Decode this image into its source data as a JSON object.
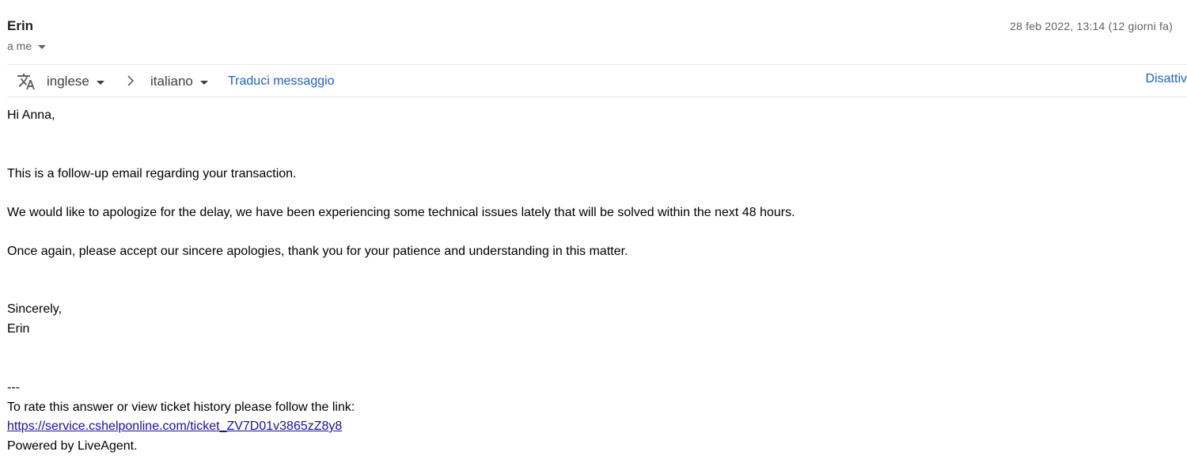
{
  "header": {
    "sender_name": "Erin",
    "recipient_label": "a me",
    "date": "28 feb 2022, 13:14 (12 giorni fa)"
  },
  "translate_bar": {
    "icon": "translate-icon",
    "source_language": "inglese",
    "target_language": "italiano",
    "translate_label": "Traduci messaggio",
    "disable_label": "Disattiv"
  },
  "email_body": {
    "greeting": "Hi Anna,",
    "paragraphs": [
      "This is a follow-up email regarding your transaction.",
      "We would like to apologize for the delay, we have been experiencing some technical issues lately that will be solved within the next 48 hours.",
      "Once again, please accept our sincere apologies, thank you for your patience and understanding in this matter."
    ],
    "closing": "Sincerely,",
    "signature": "Erin",
    "separator": "---",
    "footer_text": "To rate this answer or view ticket history please follow the link:",
    "ticket_link": "https://service.cshelponline.com/ticket_ZV7D01v3865zZ8y8",
    "powered_by": "Powered by LiveAgent."
  }
}
